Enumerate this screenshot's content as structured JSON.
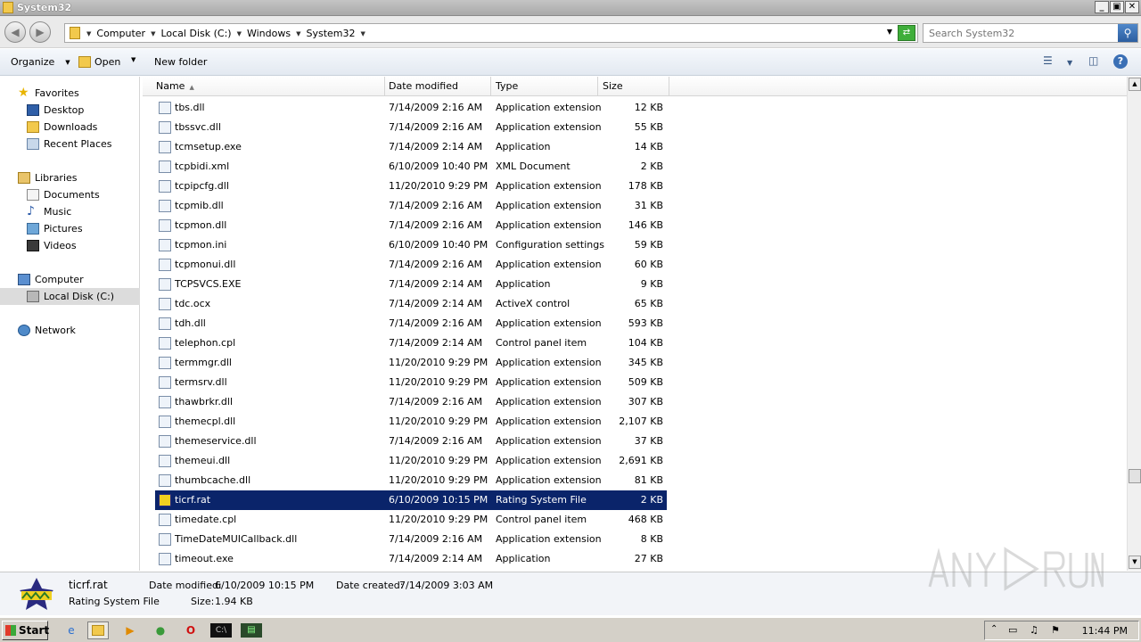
{
  "window": {
    "title": "System32",
    "controls": {
      "minimize": "_",
      "maximize": "▣",
      "close": "✕"
    }
  },
  "address": {
    "crumbs": [
      "Computer",
      "Local Disk (C:)",
      "Windows",
      "System32"
    ],
    "search_placeholder": "Search System32"
  },
  "toolbar": {
    "organize": "Organize",
    "open": "Open",
    "new_folder": "New folder"
  },
  "nav": {
    "favorites": "Favorites",
    "desktop": "Desktop",
    "downloads": "Downloads",
    "recent": "Recent Places",
    "libraries": "Libraries",
    "documents": "Documents",
    "music": "Music",
    "pictures": "Pictures",
    "videos": "Videos",
    "computer": "Computer",
    "local_disk": "Local Disk (C:)",
    "network": "Network"
  },
  "columns": {
    "name": "Name",
    "date": "Date modified",
    "type": "Type",
    "size": "Size"
  },
  "files": [
    {
      "name": "tbs.dll",
      "date": "7/14/2009 2:16 AM",
      "type": "Application extension",
      "size": "12 KB"
    },
    {
      "name": "tbssvc.dll",
      "date": "7/14/2009 2:16 AM",
      "type": "Application extension",
      "size": "55 KB"
    },
    {
      "name": "tcmsetup.exe",
      "date": "7/14/2009 2:14 AM",
      "type": "Application",
      "size": "14 KB"
    },
    {
      "name": "tcpbidi.xml",
      "date": "6/10/2009 10:40 PM",
      "type": "XML Document",
      "size": "2 KB"
    },
    {
      "name": "tcpipcfg.dll",
      "date": "11/20/2010 9:29 PM",
      "type": "Application extension",
      "size": "178 KB"
    },
    {
      "name": "tcpmib.dll",
      "date": "7/14/2009 2:16 AM",
      "type": "Application extension",
      "size": "31 KB"
    },
    {
      "name": "tcpmon.dll",
      "date": "7/14/2009 2:16 AM",
      "type": "Application extension",
      "size": "146 KB"
    },
    {
      "name": "tcpmon.ini",
      "date": "6/10/2009 10:40 PM",
      "type": "Configuration settings",
      "size": "59 KB"
    },
    {
      "name": "tcpmonui.dll",
      "date": "7/14/2009 2:16 AM",
      "type": "Application extension",
      "size": "60 KB"
    },
    {
      "name": "TCPSVCS.EXE",
      "date": "7/14/2009 2:14 AM",
      "type": "Application",
      "size": "9 KB"
    },
    {
      "name": "tdc.ocx",
      "date": "7/14/2009 2:14 AM",
      "type": "ActiveX control",
      "size": "65 KB"
    },
    {
      "name": "tdh.dll",
      "date": "7/14/2009 2:16 AM",
      "type": "Application extension",
      "size": "593 KB"
    },
    {
      "name": "telephon.cpl",
      "date": "7/14/2009 2:14 AM",
      "type": "Control panel item",
      "size": "104 KB"
    },
    {
      "name": "termmgr.dll",
      "date": "11/20/2010 9:29 PM",
      "type": "Application extension",
      "size": "345 KB"
    },
    {
      "name": "termsrv.dll",
      "date": "11/20/2010 9:29 PM",
      "type": "Application extension",
      "size": "509 KB"
    },
    {
      "name": "thawbrkr.dll",
      "date": "7/14/2009 2:16 AM",
      "type": "Application extension",
      "size": "307 KB"
    },
    {
      "name": "themecpl.dll",
      "date": "11/20/2010 9:29 PM",
      "type": "Application extension",
      "size": "2,107 KB"
    },
    {
      "name": "themeservice.dll",
      "date": "7/14/2009 2:16 AM",
      "type": "Application extension",
      "size": "37 KB"
    },
    {
      "name": "themeui.dll",
      "date": "11/20/2010 9:29 PM",
      "type": "Application extension",
      "size": "2,691 KB"
    },
    {
      "name": "thumbcache.dll",
      "date": "11/20/2010 9:29 PM",
      "type": "Application extension",
      "size": "81 KB"
    },
    {
      "name": "ticrf.rat",
      "date": "6/10/2009 10:15 PM",
      "type": "Rating System File",
      "size": "2 KB",
      "selected": true
    },
    {
      "name": "timedate.cpl",
      "date": "11/20/2010 9:29 PM",
      "type": "Control panel item",
      "size": "468 KB"
    },
    {
      "name": "TimeDateMUICallback.dll",
      "date": "7/14/2009 2:16 AM",
      "type": "Application extension",
      "size": "8 KB"
    },
    {
      "name": "timeout.exe",
      "date": "7/14/2009 2:14 AM",
      "type": "Application",
      "size": "27 KB"
    }
  ],
  "details": {
    "name": "ticrf.rat",
    "type": "Rating System File",
    "modified_label": "Date modified:",
    "modified": "6/10/2009 10:15 PM",
    "created_label": "Date created:",
    "created": "7/14/2009 3:03 AM",
    "size_label": "Size:",
    "size": "1.94 KB"
  },
  "taskbar": {
    "start": "Start",
    "clock": "11:44 PM"
  },
  "colors": {
    "selection": "#0a246a",
    "accent": "#2c5ea0"
  }
}
